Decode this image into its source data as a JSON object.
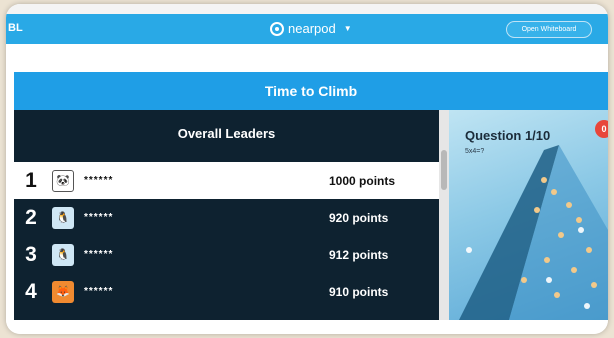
{
  "browser": {
    "bookmarks_text": ""
  },
  "topbar": {
    "left_label": "BL",
    "brand_name": "nearpod",
    "open_whiteboard": "Open Whiteboard"
  },
  "game": {
    "title": "Time to Climb"
  },
  "leaderboard": {
    "heading": "Overall Leaders",
    "rows": [
      {
        "rank": "1",
        "name": "******",
        "points": "1000 points",
        "avatar": "panda-icon"
      },
      {
        "rank": "2",
        "name": "******",
        "points": "920 points",
        "avatar": "penguin-icon"
      },
      {
        "rank": "3",
        "name": "******",
        "points": "912 points",
        "avatar": "penguin-icon"
      },
      {
        "rank": "4",
        "name": "******",
        "points": "910 points",
        "avatar": "fox-icon"
      }
    ]
  },
  "question": {
    "title": "Question 1/10",
    "subtitle": "5x4=?",
    "badge": "0"
  },
  "colors": {
    "brand_blue": "#29a9e6",
    "title_blue": "#1f9ee6",
    "board_bg": "#0e2230",
    "badge_red": "#e8463a"
  }
}
